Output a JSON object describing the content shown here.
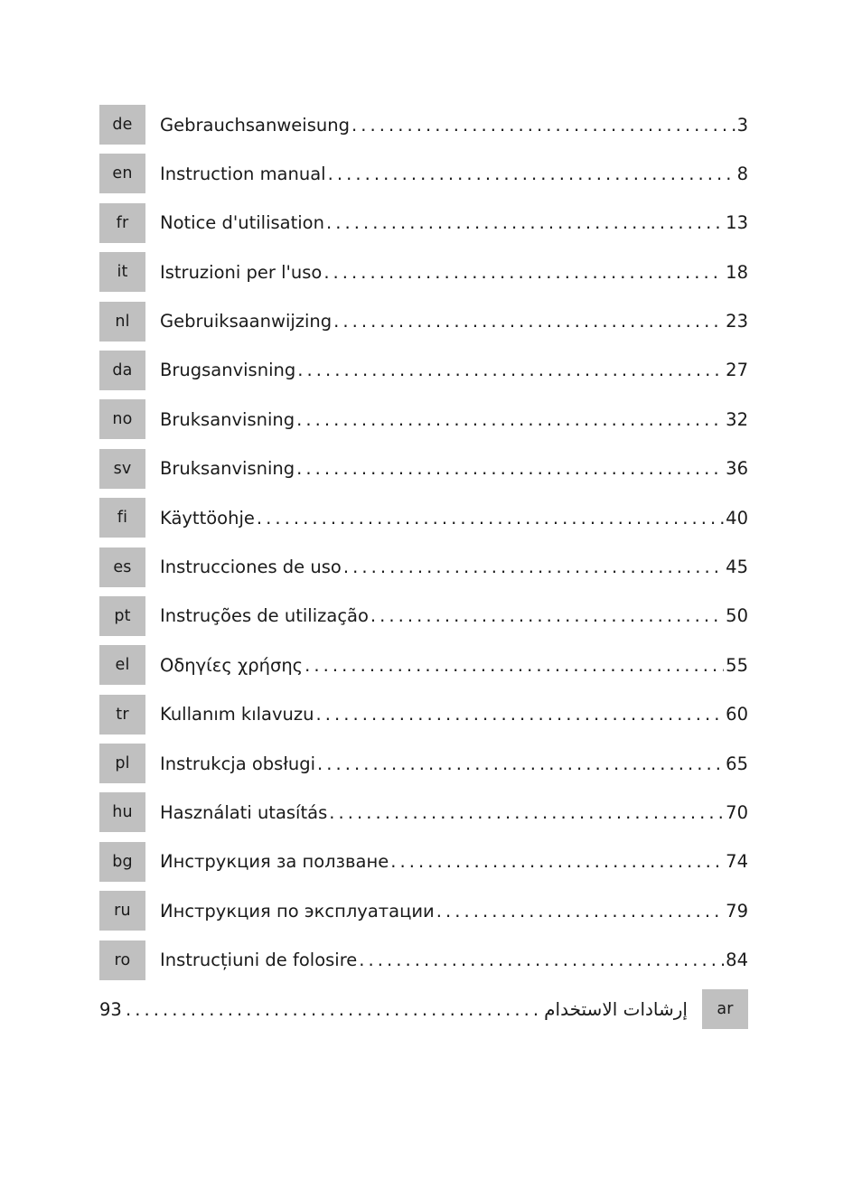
{
  "document": {
    "type": "table-of-contents",
    "badge_color": "#c0c0c0",
    "text_color": "#1a1a1a",
    "background_color": "#ffffff",
    "leader_char": "."
  },
  "entries": [
    {
      "code": "de",
      "title": "Gebrauchsanweisung",
      "page": "3",
      "dir": "ltr"
    },
    {
      "code": "en",
      "title": "Instruction manual",
      "page": "8",
      "dir": "ltr"
    },
    {
      "code": "fr",
      "title": "Notice d'utilisation",
      "page": "13",
      "dir": "ltr"
    },
    {
      "code": "it",
      "title": "Istruzioni per l'uso",
      "page": "18",
      "dir": "ltr"
    },
    {
      "code": "nl",
      "title": "Gebruiksaanwijzing",
      "page": "23",
      "dir": "ltr"
    },
    {
      "code": "da",
      "title": "Brugsanvisning",
      "page": "27",
      "dir": "ltr"
    },
    {
      "code": "no",
      "title": "Bruksanvisning",
      "page": "32",
      "dir": "ltr"
    },
    {
      "code": "sv",
      "title": "Bruksanvisning",
      "page": "36",
      "dir": "ltr"
    },
    {
      "code": "fi",
      "title": "Käyttöohje",
      "page": "40",
      "dir": "ltr"
    },
    {
      "code": "es",
      "title": "Instrucciones de uso",
      "page": "45",
      "dir": "ltr"
    },
    {
      "code": "pt",
      "title": "Instruções de utilização",
      "page": "50",
      "dir": "ltr"
    },
    {
      "code": "el",
      "title": "Οδηγίες χρήσης",
      "page": "55",
      "dir": "ltr"
    },
    {
      "code": "tr",
      "title": "Kullanım kılavuzu",
      "page": "60",
      "dir": "ltr"
    },
    {
      "code": "pl",
      "title": "Instrukcja obsługi",
      "page": "65",
      "dir": "ltr"
    },
    {
      "code": "hu",
      "title": "Használati utasítás",
      "page": "70",
      "dir": "ltr"
    },
    {
      "code": "bg",
      "title": "Инструкция за ползване",
      "page": "74",
      "dir": "ltr"
    },
    {
      "code": "ru",
      "title": "Инструкция по эксплуатации",
      "page": "79",
      "dir": "ltr"
    },
    {
      "code": "ro",
      "title": "Instrucțiuni de folosire",
      "page": "84",
      "dir": "ltr"
    },
    {
      "code": "ar",
      "title": "إرشادات الاستخدام",
      "page": "93",
      "dir": "rtl"
    }
  ]
}
